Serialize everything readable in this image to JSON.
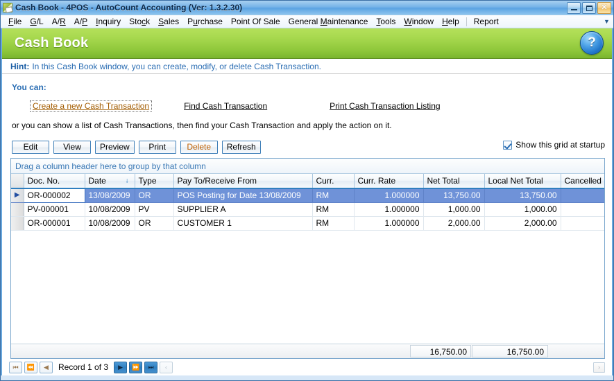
{
  "window": {
    "title": "Cash Book - 4POS - AutoCount Accounting (Ver: 1.3.2.30)",
    "icon": "document-icon",
    "minimize_label": "_",
    "maximize_label": "□",
    "close_label": "✕"
  },
  "menubar": {
    "items": [
      {
        "label": "File",
        "accel": "F"
      },
      {
        "label": "G/L",
        "accel": "G"
      },
      {
        "label": "A/R",
        "accel": "R"
      },
      {
        "label": "A/P",
        "accel": "P"
      },
      {
        "label": "Inquiry",
        "accel": "I"
      },
      {
        "label": "Stock",
        "accel": "c"
      },
      {
        "label": "Sales",
        "accel": "S"
      },
      {
        "label": "Purchase",
        "accel": "u"
      },
      {
        "label": "Point Of Sale",
        "accel": ""
      },
      {
        "label": "General Maintenance",
        "accel": "M"
      },
      {
        "label": "Tools",
        "accel": "T"
      },
      {
        "label": "Window",
        "accel": "W"
      },
      {
        "label": "Help",
        "accel": "H"
      },
      {
        "label": "Report",
        "accel": ""
      }
    ],
    "overflow_icon": "chevron-down-icon"
  },
  "banner": {
    "title": "Cash Book",
    "help_icon": "?",
    "color_start": "#b5e05a",
    "color_end": "#7ab52e"
  },
  "hint": {
    "label": "Hint:",
    "text": "In this Cash Book window, you can create, modify, or delete Cash Transaction.",
    "color": "#2a6db3"
  },
  "actions": {
    "heading": "You can:",
    "links": [
      {
        "label": "Create a new Cash Transaction",
        "focused": true
      },
      {
        "label": "Find Cash Transaction",
        "focused": false
      },
      {
        "label": "Print Cash Transaction Listing",
        "focused": false
      }
    ],
    "note": "or you can show a list of Cash Transactions, then find your Cash Transaction and apply the action on it."
  },
  "toolbar": {
    "buttons": [
      {
        "label": "Edit",
        "hot": false
      },
      {
        "label": "View",
        "hot": false
      },
      {
        "label": "Preview",
        "hot": false
      },
      {
        "label": "Print",
        "hot": false
      },
      {
        "label": "Delete",
        "hot": true
      },
      {
        "label": "Refresh",
        "hot": false
      }
    ],
    "startup_checkbox": {
      "label": "Show this grid at startup",
      "checked": true
    }
  },
  "grid": {
    "group_panel_text": "Drag a column header here to group by that column",
    "columns": [
      {
        "label": "Doc. No.",
        "align": "left",
        "sort": ""
      },
      {
        "label": "Date",
        "align": "left",
        "sort": "desc"
      },
      {
        "label": "Type",
        "align": "left",
        "sort": ""
      },
      {
        "label": "Pay To/Receive From",
        "align": "left",
        "sort": ""
      },
      {
        "label": "Curr.",
        "align": "left",
        "sort": ""
      },
      {
        "label": "Curr. Rate",
        "align": "right",
        "sort": ""
      },
      {
        "label": "Net Total",
        "align": "right",
        "sort": ""
      },
      {
        "label": "Local Net Total",
        "align": "right",
        "sort": ""
      },
      {
        "label": "Cancelled",
        "align": "left",
        "sort": ""
      }
    ],
    "sort_desc_icon": "↓",
    "row_pointer_icon": "▶",
    "rows": [
      {
        "selected": true,
        "doc_no": "OR-000002",
        "date": "13/08/2009",
        "type": "OR",
        "pay_to": "POS Posting for Date 13/08/2009",
        "curr": "RM",
        "curr_rate": "1.000000",
        "net_total": "13,750.00",
        "local_net_total": "13,750.00",
        "cancelled": ""
      },
      {
        "selected": false,
        "doc_no": "PV-000001",
        "date": "10/08/2009",
        "type": "PV",
        "pay_to": "SUPPLIER A",
        "curr": "RM",
        "curr_rate": "1.000000",
        "net_total": "1,000.00",
        "local_net_total": "1,000.00",
        "cancelled": ""
      },
      {
        "selected": false,
        "doc_no": "OR-000001",
        "date": "10/08/2009",
        "type": "OR",
        "pay_to": "CUSTOMER 1",
        "curr": "RM",
        "curr_rate": "1.000000",
        "net_total": "2,000.00",
        "local_net_total": "2,000.00",
        "cancelled": ""
      }
    ],
    "totals": {
      "net_total": "16,750.00",
      "local_net_total": "16,750.00"
    },
    "hscroll_right_icon": "›"
  },
  "navigator": {
    "first_icon": "⏮",
    "prev_page_icon": "⏪",
    "prev_icon": "◀",
    "record_text": "Record 1 of 3",
    "next_icon": "▶",
    "next_page_icon": "⏩",
    "last_icon": "⏭",
    "end_icon": "‹"
  }
}
